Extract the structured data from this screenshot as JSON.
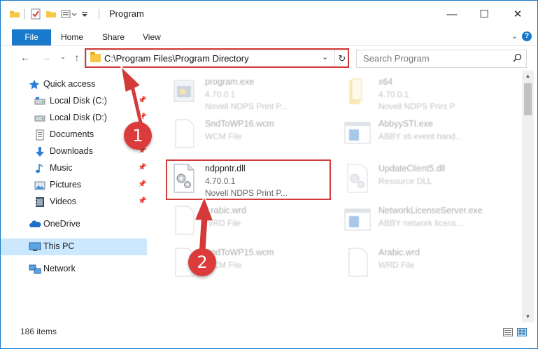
{
  "window": {
    "title": "Program",
    "controls": {
      "minimize": "—",
      "maximize": "☐",
      "close": "✕"
    }
  },
  "ribbon": {
    "tabs": [
      "File",
      "Home",
      "Share",
      "View"
    ],
    "expand_glyph": "⌄",
    "help_glyph": "?"
  },
  "navigation": {
    "back": "←",
    "forward": "→",
    "recent": "⌄",
    "up": "↑"
  },
  "address": {
    "path": "C:\\Program Files\\Program Directory",
    "chevron": "⌄",
    "refresh": "↻"
  },
  "search": {
    "placeholder": "Search Program",
    "icon": "⌕"
  },
  "sidebar": {
    "quick_access": "Quick access",
    "items": [
      {
        "label": "Local Disk (C:)",
        "icon": "drive-icon",
        "pinned": true
      },
      {
        "label": "Local Disk (D:)",
        "icon": "drive-icon",
        "pinned": true
      },
      {
        "label": "Documents",
        "icon": "documents-icon",
        "pinned": true
      },
      {
        "label": "Downloads",
        "icon": "downloads-icon",
        "pinned": true
      },
      {
        "label": "Music",
        "icon": "music-icon",
        "pinned": true
      },
      {
        "label": "Pictures",
        "icon": "pictures-icon",
        "pinned": true
      },
      {
        "label": "Videos",
        "icon": "videos-icon",
        "pinned": true
      }
    ],
    "onedrive": "OneDrive",
    "this_pc": "This PC",
    "network": "Network",
    "pin_glyph": "📌"
  },
  "files": [
    {
      "name": "program.exe",
      "version": "4.70.0.1",
      "desc": "Novell NDPS Print P...",
      "type": "exe"
    },
    {
      "name": "x64",
      "version": "4.70.0.1",
      "desc": "Novell NDPS Print P",
      "type": "folder"
    },
    {
      "name": "SndToWP16.wcm",
      "version": "WCM File",
      "desc": "",
      "type": "blank"
    },
    {
      "name": "AbbyySTI.exe",
      "version": "ABBY sti event hand...",
      "desc": "",
      "type": "app"
    },
    {
      "name": "ndppntr.dll",
      "version": "4.70.0.1",
      "desc": "Novell NDPS Print P...",
      "type": "dll"
    },
    {
      "name": "UpdateClient5.dll",
      "version": "Resource DLL",
      "desc": "",
      "type": "dll"
    },
    {
      "name": "Arabic.wrd",
      "version": "WRD File",
      "desc": "",
      "type": "blank"
    },
    {
      "name": "NetworkLicenseServer.exe",
      "version": "ABBY network licens...",
      "desc": "",
      "type": "app"
    },
    {
      "name": "SndToWP15.wcm",
      "version": "WCM File",
      "desc": "",
      "type": "blank"
    },
    {
      "name": "Arabic.wrd",
      "version": "WRD File",
      "desc": "",
      "type": "blank"
    }
  ],
  "status": {
    "items": "186 items"
  },
  "annotations": {
    "step1": "1",
    "step2": "2"
  },
  "colors": {
    "accent": "#1979ca",
    "highlight": "#d33a3a",
    "badge": "#dc3b3b",
    "selected": "#cce8ff"
  }
}
